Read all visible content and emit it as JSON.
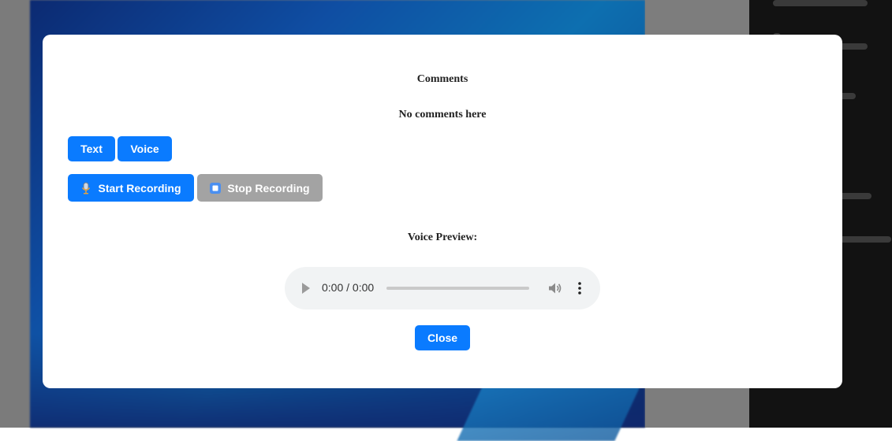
{
  "modal": {
    "title": "Comments",
    "empty_message": "No comments here",
    "mode_tabs": [
      {
        "label": "Text"
      },
      {
        "label": "Voice"
      }
    ],
    "start_recording_label": "Start Recording",
    "stop_recording_label": "Stop Recording",
    "preview_heading": "Voice Preview:",
    "audio_player": {
      "time_display": "0:00 / 0:00",
      "progress": 0,
      "play_icon": "play-icon",
      "volume_icon": "volume-icon",
      "more_icon": "more-options-icon"
    },
    "close_label": "Close"
  },
  "icons": {
    "start_recording": "microphone-icon",
    "stop_recording": "stop-icon"
  },
  "colors": {
    "primary_button": "#0a7bff",
    "disabled_button": "#a3a3a3",
    "modal_background": "#ffffff",
    "audio_player_background": "#f1f3f4"
  }
}
